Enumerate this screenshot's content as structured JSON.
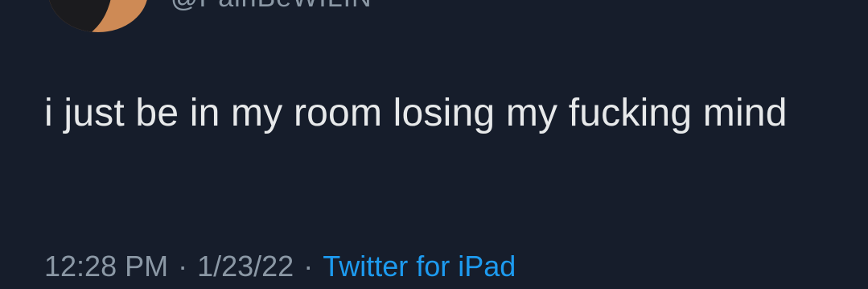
{
  "tweet": {
    "author_handle": "@PainBeWILIN",
    "text": "i just be in my room losing my fucking mind",
    "time": "12:28 PM",
    "date": "1/23/22",
    "separator": "·",
    "source": "Twitter for iPad"
  },
  "colors": {
    "background": "#161d2b",
    "text": "#e7e9ea",
    "muted": "#8b98a5",
    "link": "#1d9bf0"
  }
}
